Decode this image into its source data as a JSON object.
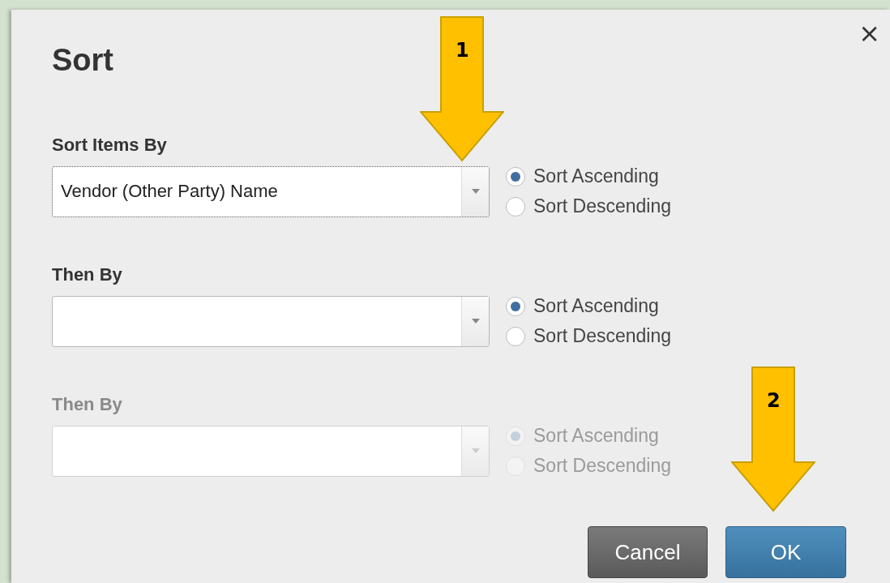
{
  "dialog": {
    "title": "Sort",
    "close": "×"
  },
  "sections": [
    {
      "label": "Sort Items By",
      "value": "Vendor (Other Party) Name",
      "disabled": false,
      "focused": true,
      "options": [
        {
          "label": "Sort Ascending",
          "selected": true
        },
        {
          "label": "Sort Descending",
          "selected": false
        }
      ]
    },
    {
      "label": "Then By",
      "disabled": false,
      "focused": false,
      "options": [
        {
          "label": "Sort Ascending",
          "selected": true
        },
        {
          "label": "Sort Descending",
          "selected": false
        }
      ]
    },
    {
      "label": "Then By",
      "disabled": true,
      "focused": false,
      "options": [
        {
          "label": "Sort Ascending",
          "selected": true
        },
        {
          "label": "Sort Descending",
          "selected": false
        }
      ]
    }
  ],
  "buttons": [
    {
      "label": "Cancel",
      "kind": "secondary"
    },
    {
      "label": "OK",
      "kind": "primary"
    }
  ],
  "callouts": [
    {
      "label": "1"
    },
    {
      "label": "2"
    }
  ]
}
